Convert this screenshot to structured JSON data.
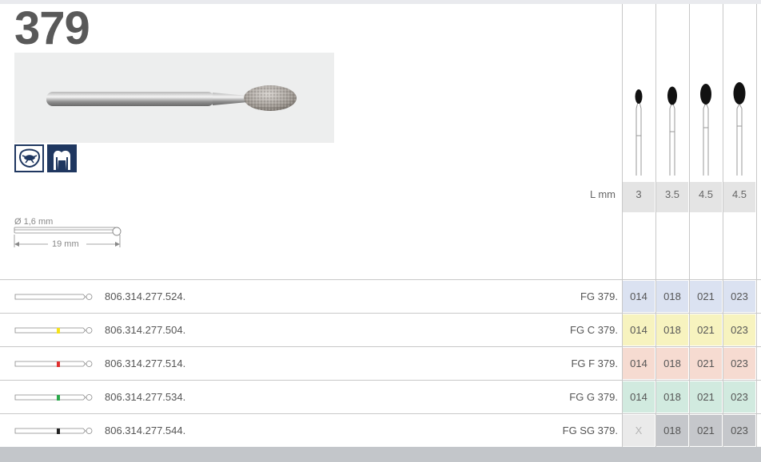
{
  "model_number": "379",
  "dimensions": {
    "diameter": "Ø 1,6 mm",
    "length": "19 mm"
  },
  "length_label": "L mm",
  "lengths": [
    "3",
    "3.5",
    "4.5",
    "4.5"
  ],
  "rows": [
    {
      "ref": "806.314.277.524.",
      "fg": "FG 379.",
      "ring_color": "",
      "bg": "#dbe2f1",
      "x_bg": "#dbe2f1",
      "sizes": [
        "014",
        "018",
        "021",
        "023"
      ]
    },
    {
      "ref": "806.314.277.504.",
      "fg": "FG C 379.",
      "ring_color": "#f5e21a",
      "bg": "#f7f3bf",
      "x_bg": "#f7f3bf",
      "sizes": [
        "014",
        "018",
        "021",
        "023"
      ]
    },
    {
      "ref": "806.314.277.514.",
      "fg": "FG F 379.",
      "ring_color": "#e03030",
      "bg": "#f6dbd1",
      "x_bg": "#f6dbd1",
      "sizes": [
        "014",
        "018",
        "021",
        "023"
      ]
    },
    {
      "ref": "806.314.277.534.",
      "fg": "FG G 379.",
      "ring_color": "#2aa84a",
      "bg": "#d1eadf",
      "x_bg": "#d1eadf",
      "sizes": [
        "014",
        "018",
        "021",
        "023"
      ]
    },
    {
      "ref": "806.314.277.544.",
      "fg": "FG SG 379.",
      "ring_color": "#222222",
      "bg": "#c5c7cb",
      "x_bg": "#eaeaea",
      "sizes": [
        "X",
        "018",
        "021",
        "023"
      ]
    }
  ]
}
